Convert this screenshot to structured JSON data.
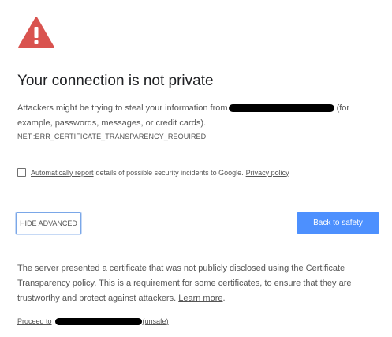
{
  "icons": {
    "warning": "warning-triangle-icon",
    "warning_color": "#d9534f"
  },
  "interstitial": {
    "title": "Your connection is not private",
    "intro_before": "Attackers might be trying to steal your information from",
    "intro_after": "(for example, passwords, messages, or credit cards).",
    "error_code": "NET::ERR_CERTIFICATE_TRANSPARENCY_REQUIRED"
  },
  "report": {
    "checked": false,
    "auto_report_link": "Automatically report",
    "text": "details of possible security incidents to Google.",
    "privacy_link": "Privacy policy"
  },
  "buttons": {
    "hide_advanced": "HIDE ADVANCED",
    "back_to_safety": "Back to safety",
    "primary_color": "#4d90fe"
  },
  "details": {
    "text": "The server presented a certificate that was not publicly disclosed using the Certificate Transparency policy. This is a requirement for some certificates, to ensure that they are trustworthy and protect against attackers.",
    "learn_more": "Learn more",
    "learn_more_suffix": "."
  },
  "proceed": {
    "prefix": "Proceed to",
    "suffix": "(unsafe)"
  }
}
